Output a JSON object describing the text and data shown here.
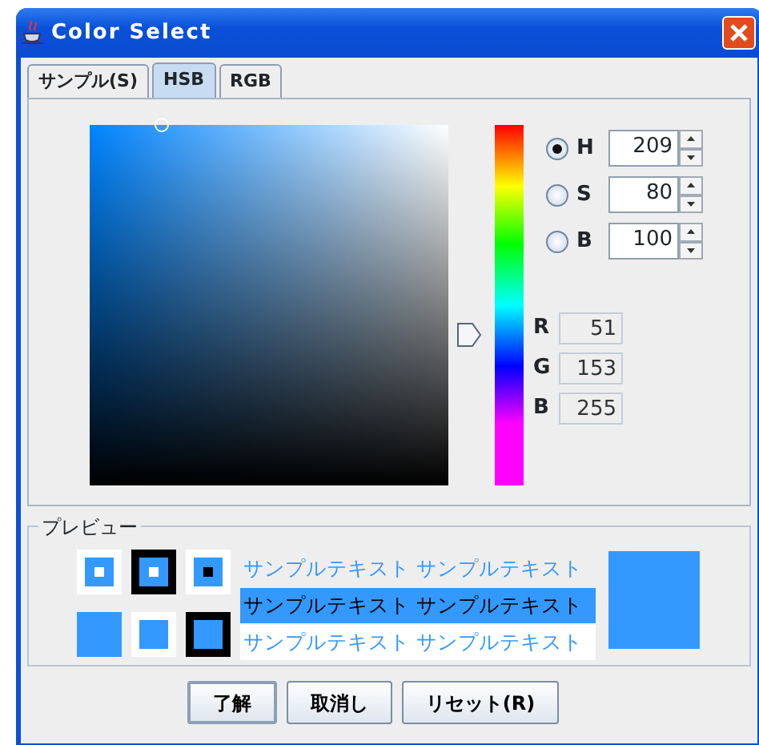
{
  "window": {
    "title": "Color Select"
  },
  "tabs": [
    {
      "label": "サンプル(S)",
      "selected": false
    },
    {
      "label": "HSB",
      "selected": true
    },
    {
      "label": "RGB",
      "selected": false
    }
  ],
  "hsb": [
    {
      "label": "H",
      "selected": true,
      "value": "209"
    },
    {
      "label": "S",
      "selected": false,
      "value": "80"
    },
    {
      "label": "B",
      "selected": false,
      "value": "100"
    }
  ],
  "rgb": [
    {
      "label": "R",
      "value": "51"
    },
    {
      "label": "G",
      "value": "153"
    },
    {
      "label": "B",
      "value": "255"
    }
  ],
  "preview": {
    "title": "プレビュー",
    "color": "#3399ff",
    "samples": [
      {
        "kind": "plain",
        "text": "サンプルテキスト サンプルテキスト"
      },
      {
        "kind": "highlight",
        "text": "サンプルテキスト サンプルテキスト"
      },
      {
        "kind": "white",
        "text": "サンプルテキスト サンプルテキスト"
      }
    ]
  },
  "buttons": [
    "了解",
    "取消し",
    "リセット(R)"
  ]
}
